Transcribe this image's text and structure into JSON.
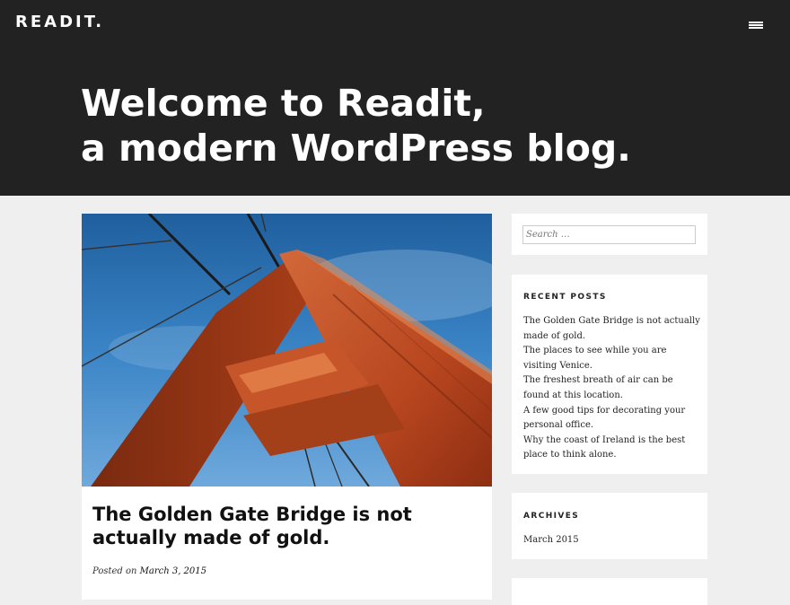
{
  "header": {
    "logo": "READIT.",
    "menu_icon": "hamburger-menu-icon",
    "hero_line1": "Welcome to Readit,",
    "hero_line2": "a modern WordPress blog."
  },
  "post": {
    "image_subject": "golden-gate-bridge-tower-photo",
    "title": "The Golden Gate Bridge is not actually made of gold.",
    "posted_on_label": "Posted on",
    "date": "March 3, 2015"
  },
  "sidebar": {
    "search_placeholder": "Search …",
    "recent_posts": {
      "title": "RECENT POSTS",
      "items": [
        {
          "label": "The Golden Gate Bridge is not actually made of gold."
        },
        {
          "label": "The places to see while you are visiting Venice."
        },
        {
          "label": "The freshest breath of air can be found at this location."
        },
        {
          "label": "A few good tips for decorating your personal office."
        },
        {
          "label": "Why the coast of Ireland is the best place to think alone."
        }
      ]
    },
    "archives": {
      "title": "ARCHIVES",
      "items": [
        {
          "label": "March 2015"
        }
      ]
    }
  },
  "colors": {
    "header_bg": "#222222",
    "page_bg": "#efefef",
    "card_bg": "#ffffff",
    "text": "#222222"
  }
}
